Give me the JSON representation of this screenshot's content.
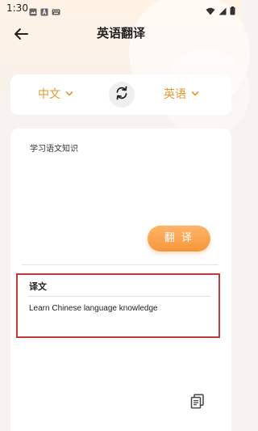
{
  "status_bar": {
    "time": "1:30",
    "icons": [
      "image-icon",
      "text-a-icon",
      "keyboard-icon",
      "wifi-icon",
      "signal-icon",
      "battery-icon"
    ]
  },
  "header": {
    "title": "英语翻译",
    "back_icon": "arrow-left-icon"
  },
  "language_bar": {
    "source_language": "中文",
    "target_language": "英语",
    "swap_icon": "swap-icon",
    "accent_color": "#e8962e"
  },
  "input": {
    "text": "学习语文知识"
  },
  "actions": {
    "translate_label": "翻 译"
  },
  "result": {
    "title": "译文",
    "text": "Learn Chinese language knowledge",
    "highlight_color": "#c0393f"
  },
  "footer": {
    "copy_icon": "copy-icon"
  }
}
